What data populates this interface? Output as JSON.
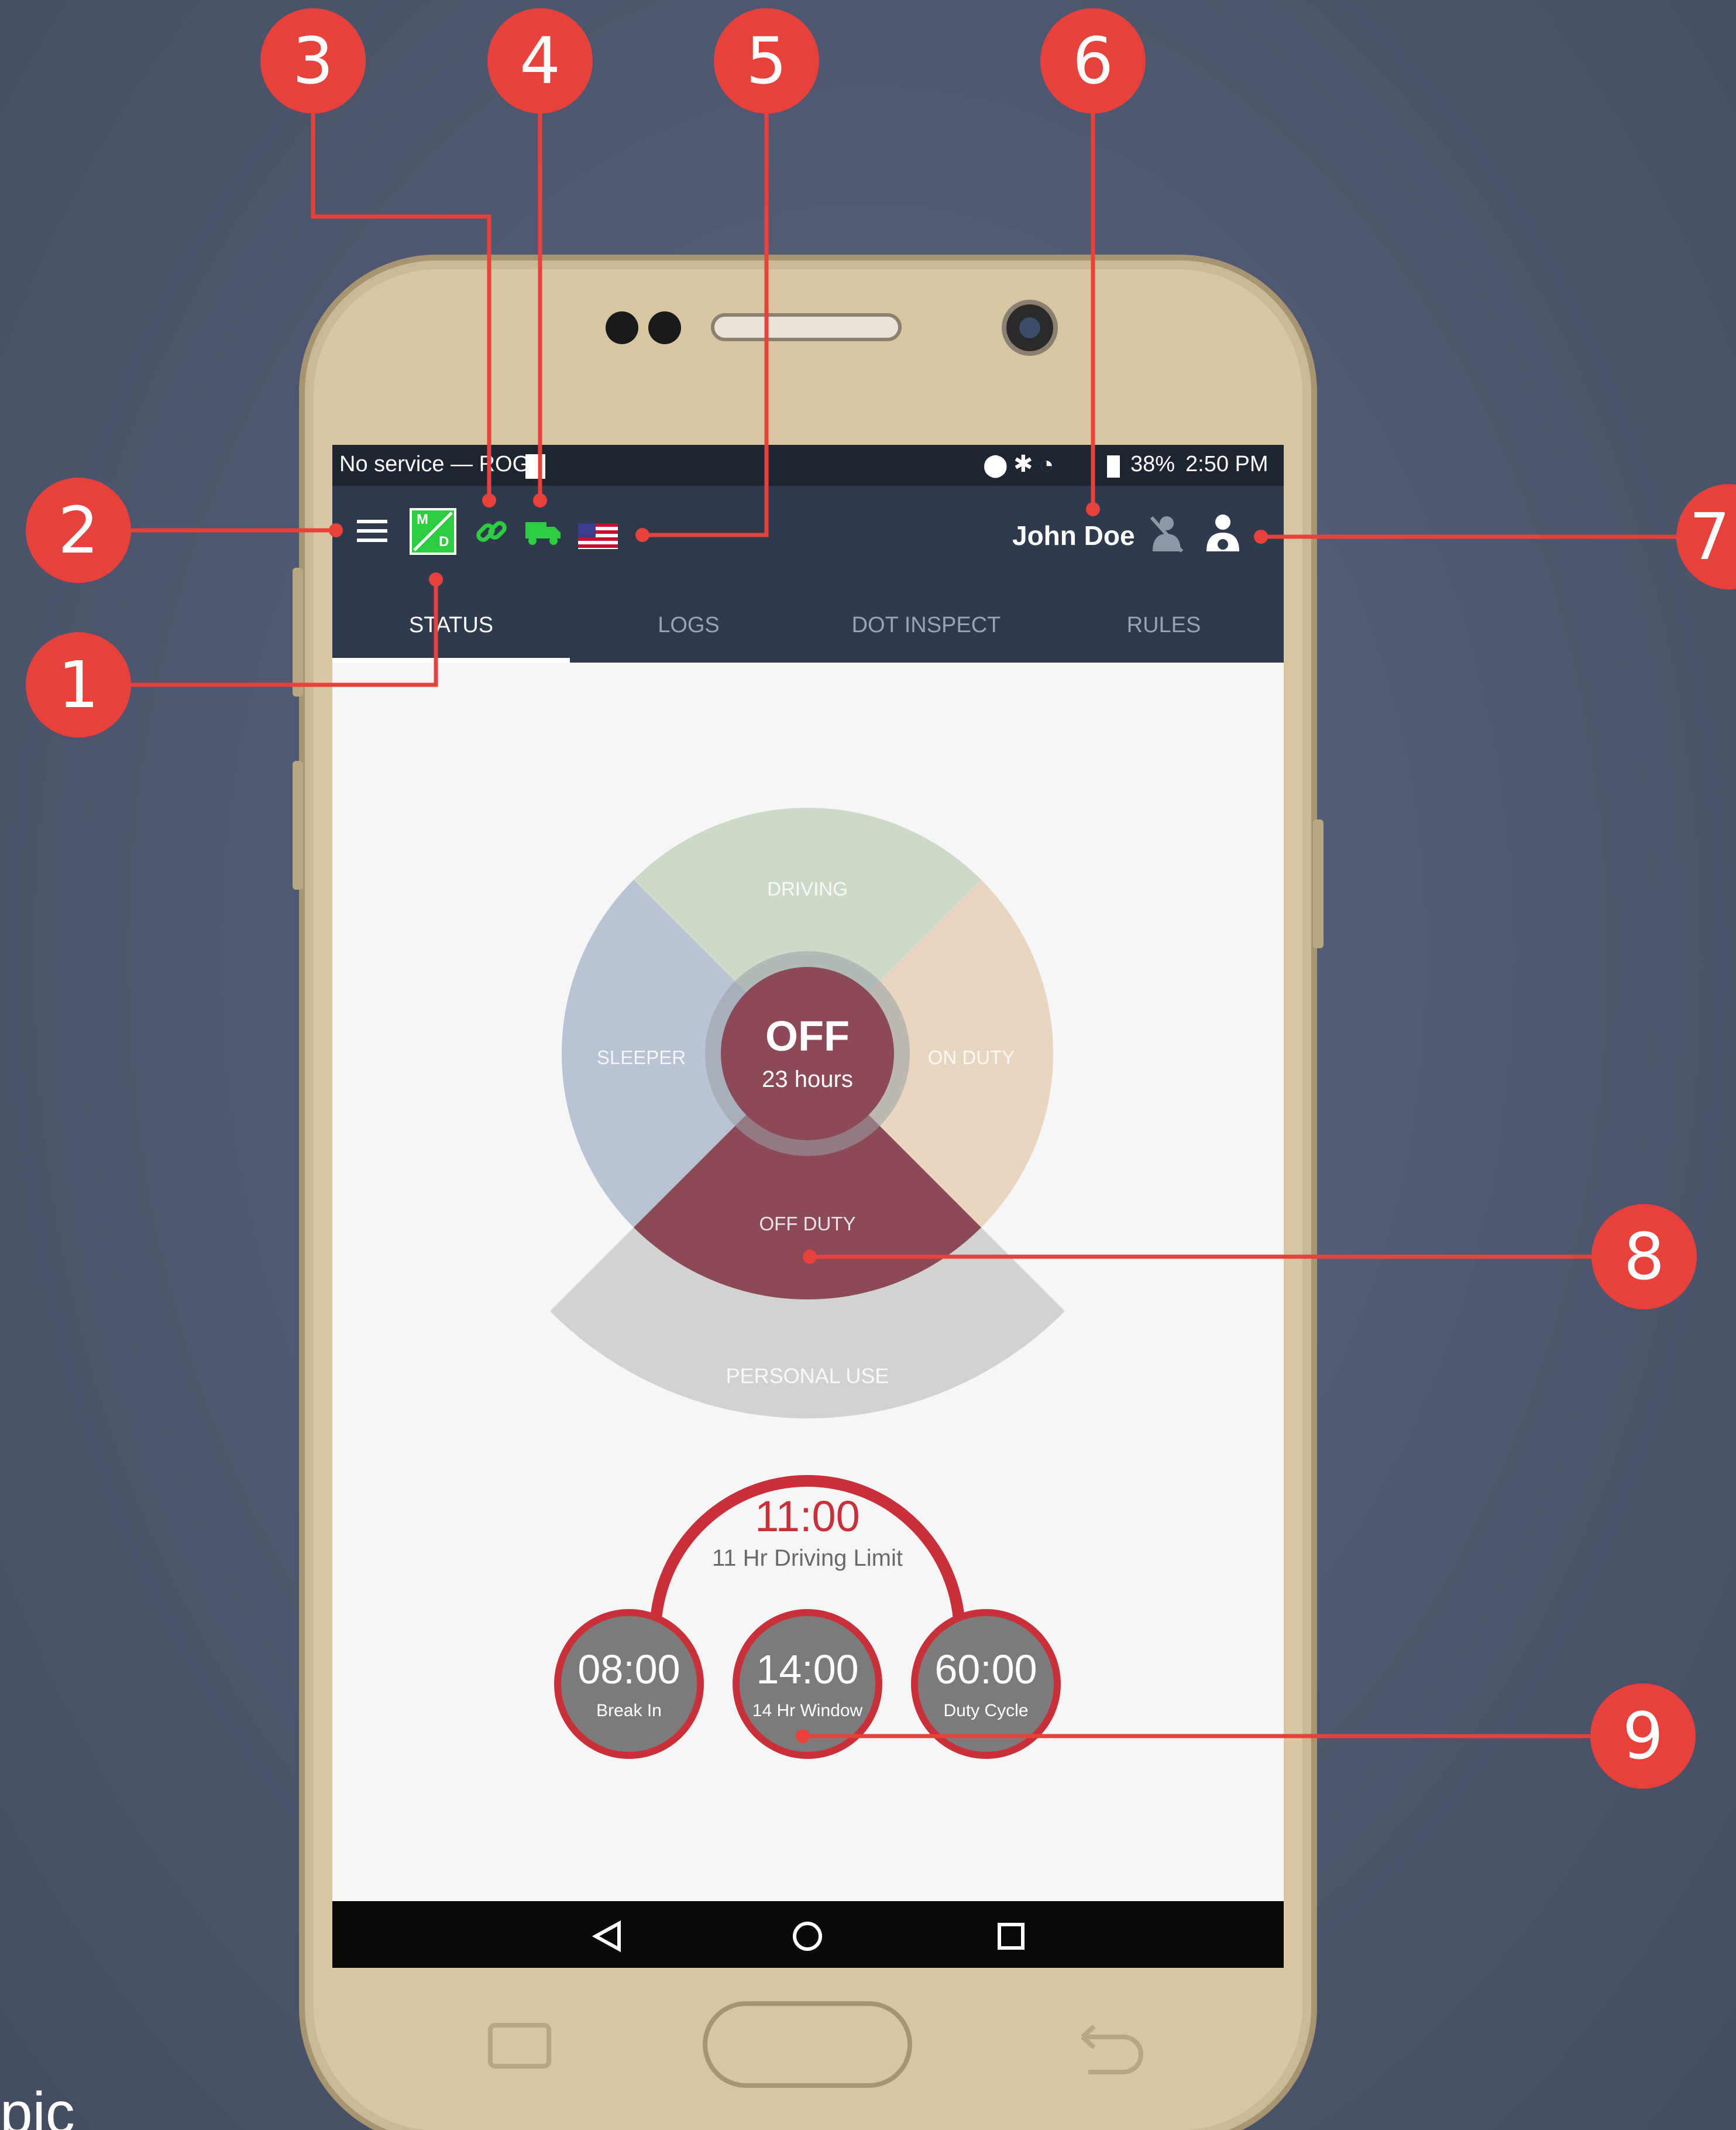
{
  "colors": {
    "background": "#4f5870",
    "phone_body": "#d4c19c",
    "app_bar": "#2d3748",
    "accent_green": "#2ecc40",
    "callout_red": "#e8413c",
    "driving": "#c9d8c6",
    "on_duty": "#e6d3bd",
    "sleeper": "#b7c1d1",
    "off_duty": "#8c4a58",
    "personal_use": "#d0d0d0",
    "timer_red": "#c9303a"
  },
  "status_bar": {
    "carrier": "No service — ROGE",
    "battery": "38%",
    "time": "2:50 PM"
  },
  "app_bar": {
    "menu_icon": "hamburger-menu-icon",
    "md_icon_top": "M",
    "md_icon_bottom": "D",
    "link_icon": "link-icon",
    "truck_icon": "truck-icon",
    "flag_icon": "us-flag-icon",
    "driver_name": "John Doe",
    "codriver_icon": "codriver-icon",
    "driver_icon": "driver-icon"
  },
  "tabs": [
    {
      "label": "STATUS",
      "active": true
    },
    {
      "label": "LOGS",
      "active": false
    },
    {
      "label": "DOT INSPECT",
      "active": false
    },
    {
      "label": "RULES",
      "active": false
    }
  ],
  "status_wheel": {
    "driving": "DRIVING",
    "on_duty": "ON DUTY",
    "sleeper": "SLEEPER",
    "off_duty": "OFF DUTY",
    "personal_use": "PERSONAL USE",
    "current_status": "OFF",
    "current_duration": "23 hours"
  },
  "timers": {
    "main": {
      "value": "11:00",
      "label": "11 Hr Driving Limit"
    },
    "break": {
      "value": "08:00",
      "label": "Break In"
    },
    "window": {
      "value": "14:00",
      "label": "14 Hr Window"
    },
    "cycle": {
      "value": "60:00",
      "label": "Duty Cycle"
    }
  },
  "nav_bar": {
    "back_icon": "back-triangle-icon",
    "home_icon": "home-circle-icon",
    "recents_icon": "recents-square-icon"
  },
  "callouts": [
    "1",
    "2",
    "3",
    "4",
    "5",
    "6",
    "7",
    "8",
    "9"
  ],
  "corner_text": "pic"
}
